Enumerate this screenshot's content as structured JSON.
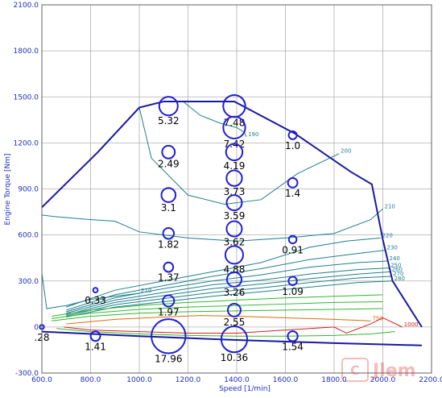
{
  "chart_data": {
    "type": "scatter",
    "subtype": "engine fuel-consumption map (BSFC contours with bubble operating points)",
    "title": "",
    "xlabel": "Speed [1/min]",
    "ylabel": "Engine Torque [Nm]",
    "xlim": [
      600,
      2200
    ],
    "ylim": [
      -300,
      2100
    ],
    "x_ticks": [
      "600.0",
      "800.0",
      "1000.0",
      "1200.0",
      "1400.0",
      "1600.0",
      "1800.0",
      "2000.0",
      "2200.0"
    ],
    "y_ticks": [
      "-300.0",
      "0",
      "300.0",
      "600.0",
      "900.0",
      "1200.0",
      "1500.0",
      "1800.0",
      "2100.0"
    ],
    "grid": true,
    "colors": {
      "axis_text": "#1f2fbf",
      "grid": "#b0b0b0",
      "max_torque_curve": "#1a1a9e",
      "bubble": "#1f1fd6",
      "contour_teal": "#1f7f8c",
      "contour_green": "#2fb82f",
      "contour_red": "#d62020",
      "contour_orange": "#e06a10"
    },
    "max_torque_curve": {
      "x": [
        600,
        830,
        1000,
        1100,
        1390,
        1640,
        1870,
        1955,
        2000,
        2040,
        2160
      ],
      "y": [
        780,
        1140,
        1430,
        1470,
        1470,
        1260,
        1010,
        930,
        570,
        300,
        0
      ]
    },
    "motoring_curve": {
      "x": [
        600,
        1000,
        1400,
        1800,
        2160
      ],
      "y": [
        -30,
        -60,
        -85,
        -105,
        -120
      ]
    },
    "contour_lines": [
      {
        "label": "190",
        "color": "teal",
        "x": [
          1180,
          1250,
          1330,
          1400,
          1430,
          1440
        ],
        "y": [
          1470,
          1380,
          1330,
          1300,
          1270,
          1240
        ]
      },
      {
        "label": "200",
        "color": "teal",
        "x": [
          1000,
          1050,
          1200,
          1350,
          1500,
          1650,
          1820
        ],
        "y": [
          1430,
          1100,
          860,
          800,
          830,
          1000,
          1130
        ]
      },
      {
        "label": "210",
        "color": "teal",
        "x": [
          600,
          650,
          800,
          900,
          1000,
          1200,
          1400,
          1600,
          1800,
          1950,
          2000
        ],
        "y": [
          730,
          720,
          700,
          690,
          620,
          580,
          560,
          580,
          610,
          700,
          770
        ]
      },
      {
        "label": "210",
        "color": "teal",
        "x": [
          600,
          620,
          700,
          800,
          900,
          1000
        ],
        "y": [
          350,
          120,
          140,
          180,
          200,
          220
        ]
      },
      {
        "label": "220",
        "color": "teal",
        "x": [
          700,
          900,
          1100,
          1300,
          1500,
          1700,
          1850,
          1990
        ],
        "y": [
          130,
          240,
          300,
          360,
          420,
          520,
          560,
          580
        ]
      },
      {
        "label": "230",
        "color": "teal",
        "x": [
          700,
          900,
          1100,
          1300,
          1500,
          1700,
          1900,
          2010
        ],
        "y": [
          110,
          210,
          270,
          330,
          380,
          440,
          480,
          500
        ]
      },
      {
        "label": "240",
        "color": "teal",
        "x": [
          700,
          900,
          1100,
          1300,
          1500,
          1700,
          1900,
          2020
        ],
        "y": [
          100,
          190,
          250,
          300,
          340,
          390,
          420,
          430
        ]
      },
      {
        "label": "250",
        "color": "teal",
        "x": [
          700,
          900,
          1100,
          1300,
          1500,
          1700,
          1900,
          2025
        ],
        "y": [
          90,
          175,
          225,
          275,
          305,
          345,
          375,
          385
        ]
      },
      {
        "label": "260",
        "color": "teal",
        "x": [
          700,
          900,
          1100,
          1300,
          1500,
          1700,
          1900,
          2030
        ],
        "y": [
          80,
          160,
          205,
          250,
          280,
          315,
          345,
          360
        ]
      },
      {
        "label": "270",
        "color": "teal",
        "x": [
          700,
          900,
          1100,
          1300,
          1500,
          1700,
          1900,
          2035
        ],
        "y": [
          72,
          145,
          185,
          225,
          255,
          290,
          320,
          330
        ]
      },
      {
        "label": "280",
        "color": "teal",
        "x": [
          700,
          900,
          1100,
          1300,
          1500,
          1700,
          1900,
          2040
        ],
        "y": [
          65,
          130,
          165,
          200,
          230,
          260,
          290,
          300
        ]
      },
      {
        "label": "",
        "color": "green",
        "x": [
          640,
          800,
          1000,
          1200,
          1400,
          1600,
          1800,
          2000
        ],
        "y": [
          70,
          110,
          140,
          160,
          175,
          190,
          200,
          210
        ]
      },
      {
        "label": "",
        "color": "green",
        "x": [
          640,
          800,
          1000,
          1200,
          1400,
          1600,
          1800,
          2000
        ],
        "y": [
          55,
          90,
          115,
          130,
          140,
          150,
          160,
          165
        ]
      },
      {
        "label": "",
        "color": "green",
        "x": [
          640,
          800,
          1000,
          1200,
          1400,
          1600,
          1800,
          2000
        ],
        "y": [
          40,
          70,
          90,
          100,
          105,
          110,
          115,
          120
        ]
      },
      {
        "label": "750",
        "color": "orange",
        "x": [
          700,
          900,
          1100,
          1250,
          1400,
          1600,
          1800,
          1950
        ],
        "y": [
          20,
          50,
          65,
          75,
          70,
          60,
          50,
          40
        ]
      },
      {
        "label": "1000",
        "color": "red",
        "x": [
          690,
          800,
          1000,
          1200,
          1400,
          1600,
          1800,
          1850,
          1950,
          2000,
          2080
        ],
        "y": [
          0,
          -20,
          -30,
          -40,
          -40,
          -20,
          0,
          -40,
          20,
          60,
          0
        ]
      },
      {
        "label": "",
        "color": "green",
        "x": [
          660,
          800,
          1000,
          1200,
          1400,
          1600,
          1800,
          1950,
          2050
        ],
        "y": [
          -10,
          -30,
          -45,
          -55,
          -60,
          -60,
          -55,
          -45,
          -30
        ]
      }
    ],
    "points": [
      {
        "x": 1120,
        "y": 1440,
        "size": 5.32,
        "label": "5.32"
      },
      {
        "x": 1390,
        "y": 1440,
        "size": 7.48,
        "label": "7.48"
      },
      {
        "x": 1390,
        "y": 1300,
        "size": 7.42,
        "label": "7.42"
      },
      {
        "x": 1630,
        "y": 1250,
        "size": 1.0,
        "label": "1.0"
      },
      {
        "x": 1120,
        "y": 1140,
        "size": 2.49,
        "label": "2.49"
      },
      {
        "x": 1390,
        "y": 1140,
        "size": 4.19,
        "label": "4.19"
      },
      {
        "x": 1390,
        "y": 970,
        "size": 3.73,
        "label": "3.73"
      },
      {
        "x": 1630,
        "y": 940,
        "size": 1.4,
        "label": "1.4"
      },
      {
        "x": 1120,
        "y": 860,
        "size": 3.1,
        "label": "3.1"
      },
      {
        "x": 1390,
        "y": 810,
        "size": 3.59,
        "label": "3.59"
      },
      {
        "x": 1120,
        "y": 610,
        "size": 1.82,
        "label": "1.82"
      },
      {
        "x": 1390,
        "y": 640,
        "size": 3.62,
        "label": "3.62"
      },
      {
        "x": 1630,
        "y": 570,
        "size": 0.91,
        "label": "0.91"
      },
      {
        "x": 1390,
        "y": 470,
        "size": 4.88,
        "label": "4.88"
      },
      {
        "x": 1120,
        "y": 390,
        "size": 1.37,
        "label": "1.37"
      },
      {
        "x": 1390,
        "y": 310,
        "size": 3.26,
        "label": "3.26"
      },
      {
        "x": 1630,
        "y": 300,
        "size": 1.09,
        "label": "1.09"
      },
      {
        "x": 820,
        "y": 240,
        "size": 0.33,
        "label": "0.33"
      },
      {
        "x": 1120,
        "y": 170,
        "size": 1.97,
        "label": "1.97"
      },
      {
        "x": 1390,
        "y": 110,
        "size": 2.55,
        "label": "2.55"
      },
      {
        "x": 600,
        "y": 0,
        "size": 0.28,
        "label": ".28"
      },
      {
        "x": 820,
        "y": -60,
        "size": 1.41,
        "label": "1.41"
      },
      {
        "x": 1120,
        "y": -60,
        "size": 17.96,
        "label": "17.96"
      },
      {
        "x": 1390,
        "y": -80,
        "size": 10.36,
        "label": "10.36"
      },
      {
        "x": 1630,
        "y": -60,
        "size": 1.54,
        "label": "1.54"
      }
    ]
  }
}
